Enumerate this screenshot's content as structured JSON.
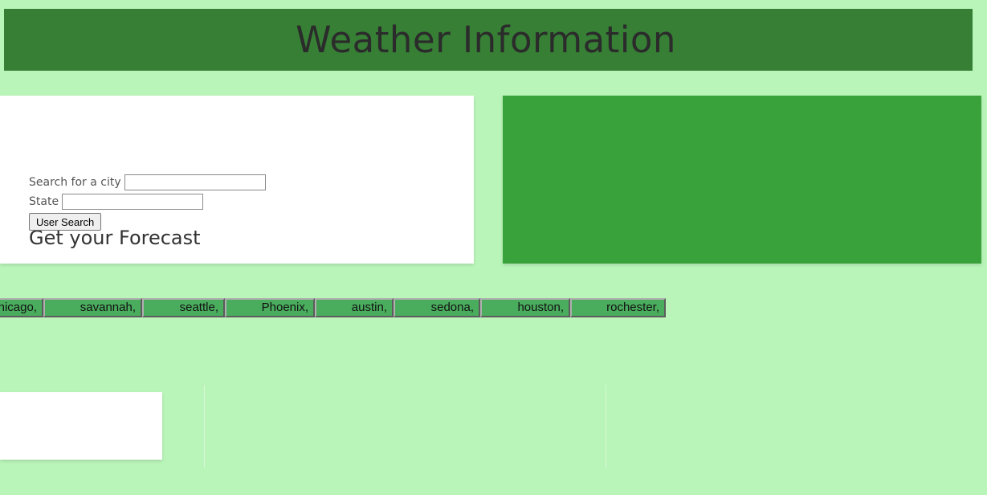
{
  "header": {
    "title": "Weather Information"
  },
  "search": {
    "title": "Get your Forecast",
    "city_label": "Search for a city",
    "city_value": "",
    "state_label": "State",
    "state_value": "",
    "button_label": "User Search"
  },
  "history": [
    "chicago,",
    "savannah,",
    "seattle,",
    "Phoenix,",
    "austin,",
    "sedona,",
    "houston,",
    "rochester,"
  ],
  "colors": {
    "background": "#b9f5b9",
    "header": "#367f35",
    "result_panel": "#3aa23a",
    "history_button": "#4aad5e"
  }
}
